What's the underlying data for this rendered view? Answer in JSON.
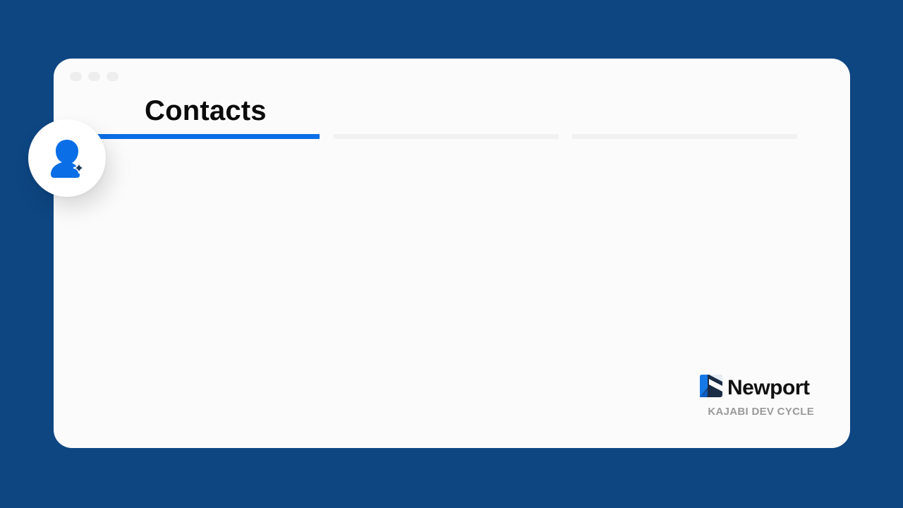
{
  "page": {
    "title": "Contacts"
  },
  "steps": {
    "count": 3,
    "active_index": 0
  },
  "icons": {
    "avatar": "user-sparkle-icon",
    "brand_logo": "newport-logo-icon"
  },
  "brand": {
    "name": "Newport",
    "subtitle": "KAJABI DEV CYCLE"
  },
  "colors": {
    "background": "#0e4682",
    "window": "#fbfbfb",
    "accent": "#0a6ee6",
    "inactive_step": "#f1f1f1",
    "subtitle": "#9a9a9a"
  }
}
